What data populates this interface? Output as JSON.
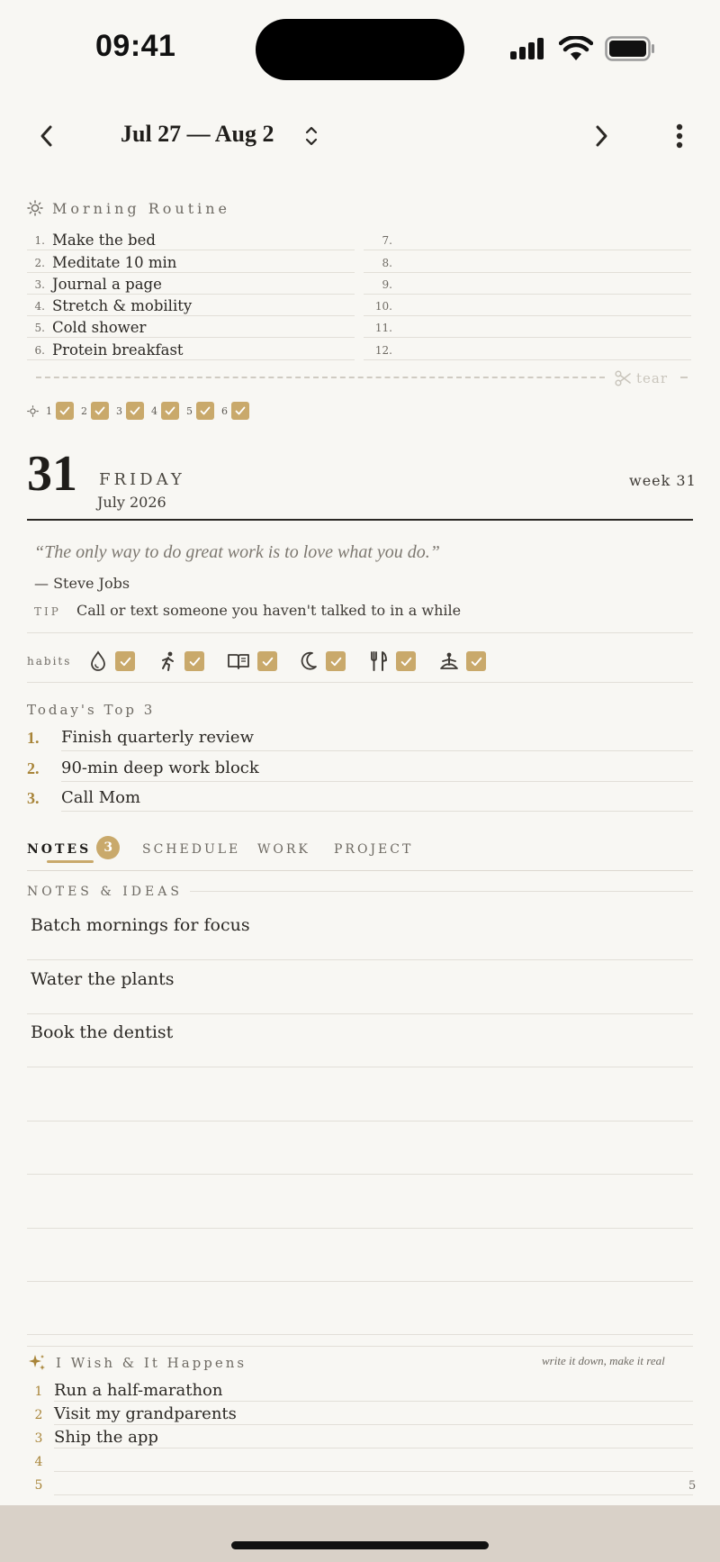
{
  "status": {
    "time": "09:41"
  },
  "header": {
    "range": "Jul 27 — Aug 2"
  },
  "morning": {
    "title": "Morning Routine",
    "items": [
      {
        "num": "1.",
        "text": "Make the bed"
      },
      {
        "num": "2.",
        "text": "Meditate 10 min"
      },
      {
        "num": "3.",
        "text": "Journal a page"
      },
      {
        "num": "4.",
        "text": "Stretch & mobility"
      },
      {
        "num": "5.",
        "text": "Cold shower"
      },
      {
        "num": "6.",
        "text": "Protein breakfast"
      },
      {
        "num": "7.",
        "text": ""
      },
      {
        "num": "8.",
        "text": ""
      },
      {
        "num": "9.",
        "text": ""
      },
      {
        "num": "10.",
        "text": ""
      },
      {
        "num": "11.",
        "text": ""
      },
      {
        "num": "12.",
        "text": ""
      }
    ],
    "tear_label": "tear",
    "checks": [
      "1",
      "2",
      "3",
      "4",
      "5",
      "6"
    ]
  },
  "date": {
    "day": "31",
    "weekday": "FRIDAY",
    "month_year": "July 2026",
    "week": "week 31"
  },
  "quote": {
    "text": "“The only way to do great work is to love what you do.”",
    "author": "— Steve Jobs",
    "tip_label": "TIP",
    "tip_text": "Call or text someone you haven't talked to in a while"
  },
  "habits": {
    "label": "habits",
    "items": [
      {
        "icon": "water-drop-icon",
        "done": true
      },
      {
        "icon": "running-icon",
        "done": true
      },
      {
        "icon": "book-icon",
        "done": true
      },
      {
        "icon": "moon-icon",
        "done": true
      },
      {
        "icon": "fork-knife-icon",
        "done": true
      },
      {
        "icon": "meditation-icon",
        "done": true
      }
    ]
  },
  "top3": {
    "title": "Today's Top 3",
    "items": [
      {
        "num": "1.",
        "text": "Finish quarterly review"
      },
      {
        "num": "2.",
        "text": "90-min deep work block"
      },
      {
        "num": "3.",
        "text": "Call Mom"
      }
    ]
  },
  "tabs": {
    "items": [
      "NOTES",
      "SCHEDULE",
      "WORK",
      "PROJECT"
    ],
    "active": "NOTES",
    "badge": "3"
  },
  "notes": {
    "title": "NOTES & IDEAS",
    "items": [
      "Batch mornings for focus",
      "Water the plants",
      "Book the dentist",
      "",
      "",
      "",
      "",
      ""
    ]
  },
  "wish": {
    "title": "I Wish & It Happens",
    "subtitle": "write it down, make it real",
    "items": [
      {
        "num": "1",
        "text": "Run a half-marathon"
      },
      {
        "num": "2",
        "text": "Visit my grandparents"
      },
      {
        "num": "3",
        "text": "Ship the app"
      },
      {
        "num": "4",
        "text": ""
      },
      {
        "num": "5",
        "text": ""
      }
    ],
    "page": "5"
  },
  "colors": {
    "accent": "#c9a96b",
    "accent_text": "#a88438",
    "background": "#f8f7f3",
    "ink": "#2b2824"
  }
}
